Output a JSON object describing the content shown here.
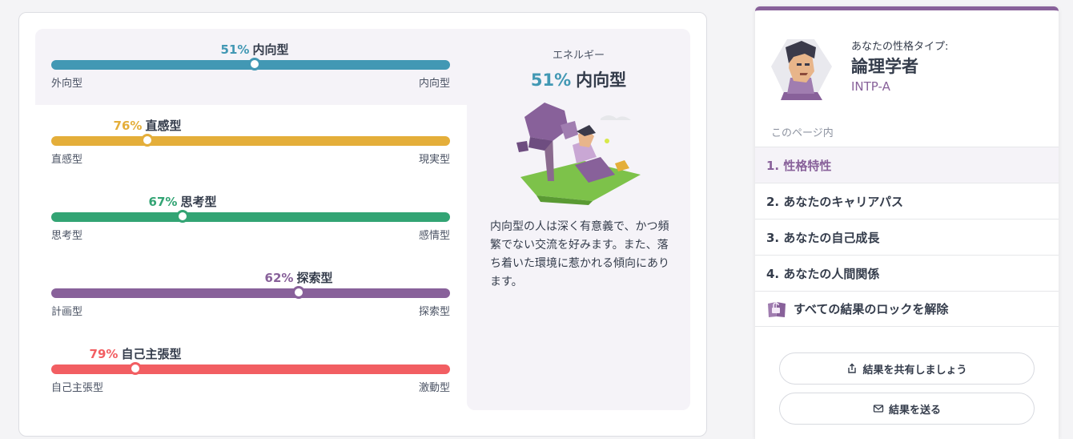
{
  "traits": [
    {
      "pct": "51%",
      "name": "内向型",
      "left": "外向型",
      "right": "内向型",
      "color": "#4298b4",
      "value": 0.51,
      "side": "right"
    },
    {
      "pct": "76%",
      "name": "直感型",
      "left": "直感型",
      "right": "現実型",
      "color": "#e4ae3a",
      "value": 0.76,
      "side": "left"
    },
    {
      "pct": "67%",
      "name": "思考型",
      "left": "思考型",
      "right": "感情型",
      "color": "#33a474",
      "value": 0.67,
      "side": "left"
    },
    {
      "pct": "62%",
      "name": "探索型",
      "left": "計画型",
      "right": "探索型",
      "color": "#88619a",
      "value": 0.62,
      "side": "right"
    },
    {
      "pct": "79%",
      "name": "自己主張型",
      "left": "自己主張型",
      "right": "激動型",
      "color": "#f25e62",
      "value": 0.79,
      "side": "left"
    }
  ],
  "detail": {
    "category": "エネルギー",
    "pct": "51%",
    "name": "内向型",
    "text": "内向型の人は深く有意義で、かつ頻繁でない交流を好みます。また、落ち着いた環境に惹かれる傾向にあります。"
  },
  "sidebar": {
    "kicker": "あなたの性格タイプ:",
    "type_name": "論理学者",
    "type_code": "INTP-A",
    "toc_title": "このページ内",
    "items": [
      "1. 性格特性",
      "2. あなたのキャリアパス",
      "3. あなたの自己成長",
      "4. あなたの人間関係"
    ],
    "unlock": "すべての結果のロックを解除",
    "share": "結果を共有しましょう",
    "send": "結果を送る"
  },
  "icons": [
    "avatar-illustration",
    "reading-person-illustration",
    "unlock-book-icon",
    "share-icon",
    "mail-icon"
  ]
}
